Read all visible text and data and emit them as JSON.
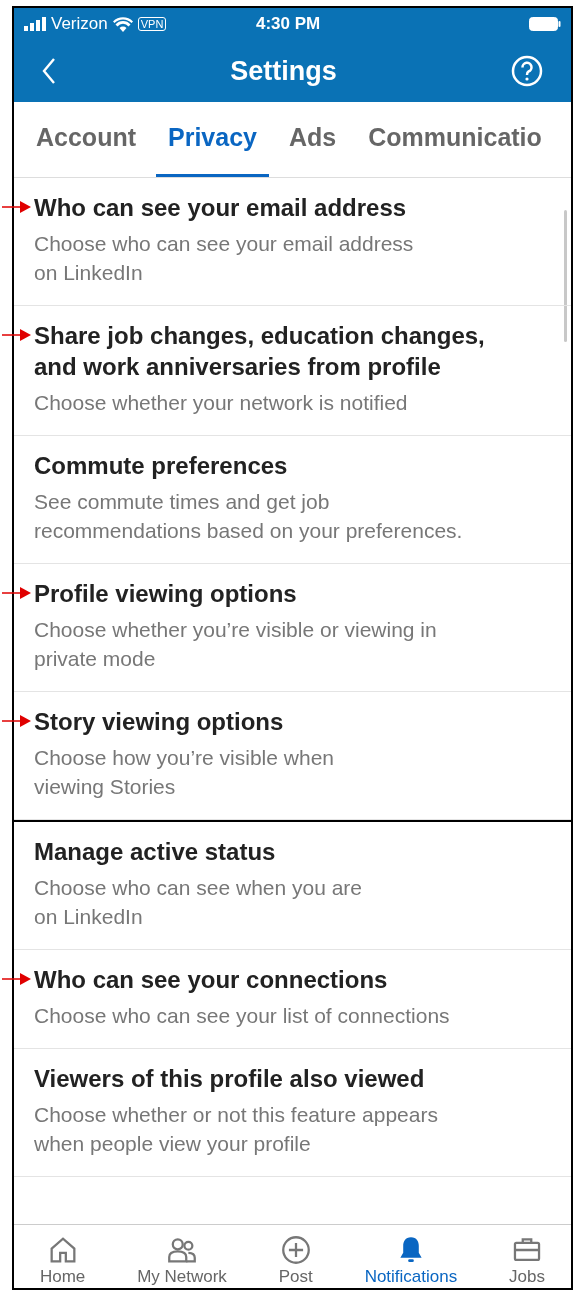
{
  "status_bar": {
    "carrier": "Verizon",
    "vpn": "VPN",
    "time": "4:30 PM"
  },
  "header": {
    "title": "Settings"
  },
  "tabs": [
    {
      "label": "Account",
      "selected": false
    },
    {
      "label": "Privacy",
      "selected": true
    },
    {
      "label": "Ads",
      "selected": false
    },
    {
      "label": "Communicatio",
      "selected": false
    }
  ],
  "panels": [
    {
      "rows": [
        {
          "title": "Who can see your email address",
          "description": "Choose who can see your email address\non LinkedIn",
          "marked": true
        },
        {
          "title": "Share job changes, education changes,\nand work anniversaries from profile",
          "description": "Choose whether your network is notified",
          "marked": true
        },
        {
          "title": "Commute preferences",
          "description": "See commute times and get job\nrecommendations based on your preferences.",
          "marked": false
        },
        {
          "title": "Profile viewing options",
          "description": "Choose whether you’re visible or viewing in\nprivate mode",
          "marked": true
        },
        {
          "title": "Story viewing options",
          "description": "Choose how you’re visible when\nviewing Stories",
          "marked": true
        }
      ]
    },
    {
      "rows": [
        {
          "title": "Manage active status",
          "description": "Choose who can see when you are\non LinkedIn",
          "marked": false
        },
        {
          "title": "Who can see your connections",
          "description": "Choose who can see your list of connections",
          "marked": true
        },
        {
          "title": "Viewers of this profile also viewed",
          "description": "Choose whether or not this feature appears\nwhen people view your profile",
          "marked": false
        }
      ]
    }
  ],
  "bottom_nav": [
    {
      "kind": "home",
      "label": "Home",
      "selected": false
    },
    {
      "kind": "network",
      "label": "My Network",
      "selected": false
    },
    {
      "kind": "post",
      "label": "Post",
      "selected": false
    },
    {
      "kind": "bell",
      "label": "Notifications",
      "selected": true
    },
    {
      "kind": "jobs",
      "label": "Jobs",
      "selected": false
    }
  ]
}
